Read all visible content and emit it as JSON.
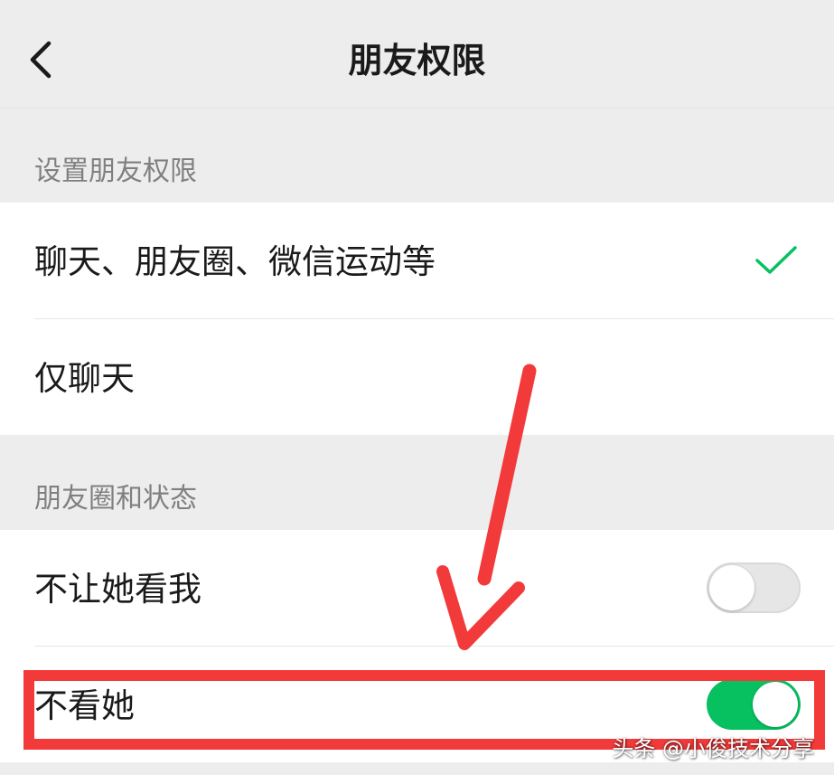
{
  "nav": {
    "title": "朋友权限",
    "back_icon": "chevron-left-icon"
  },
  "sections": [
    {
      "header": "设置朋友权限",
      "items": [
        {
          "label": "聊天、朋友圈、微信运动等",
          "selected": true
        },
        {
          "label": "仅聊天",
          "selected": false
        }
      ]
    },
    {
      "header": "朋友圈和状态",
      "items": [
        {
          "label": "不让她看我",
          "toggle": false
        },
        {
          "label": "不看她",
          "toggle": true
        }
      ]
    }
  ],
  "colors": {
    "accent": "#07c160",
    "annotation": "#f23a3a",
    "background": "#ededed",
    "cell": "#ffffff"
  },
  "watermark": "头条 @小俊技术分享"
}
